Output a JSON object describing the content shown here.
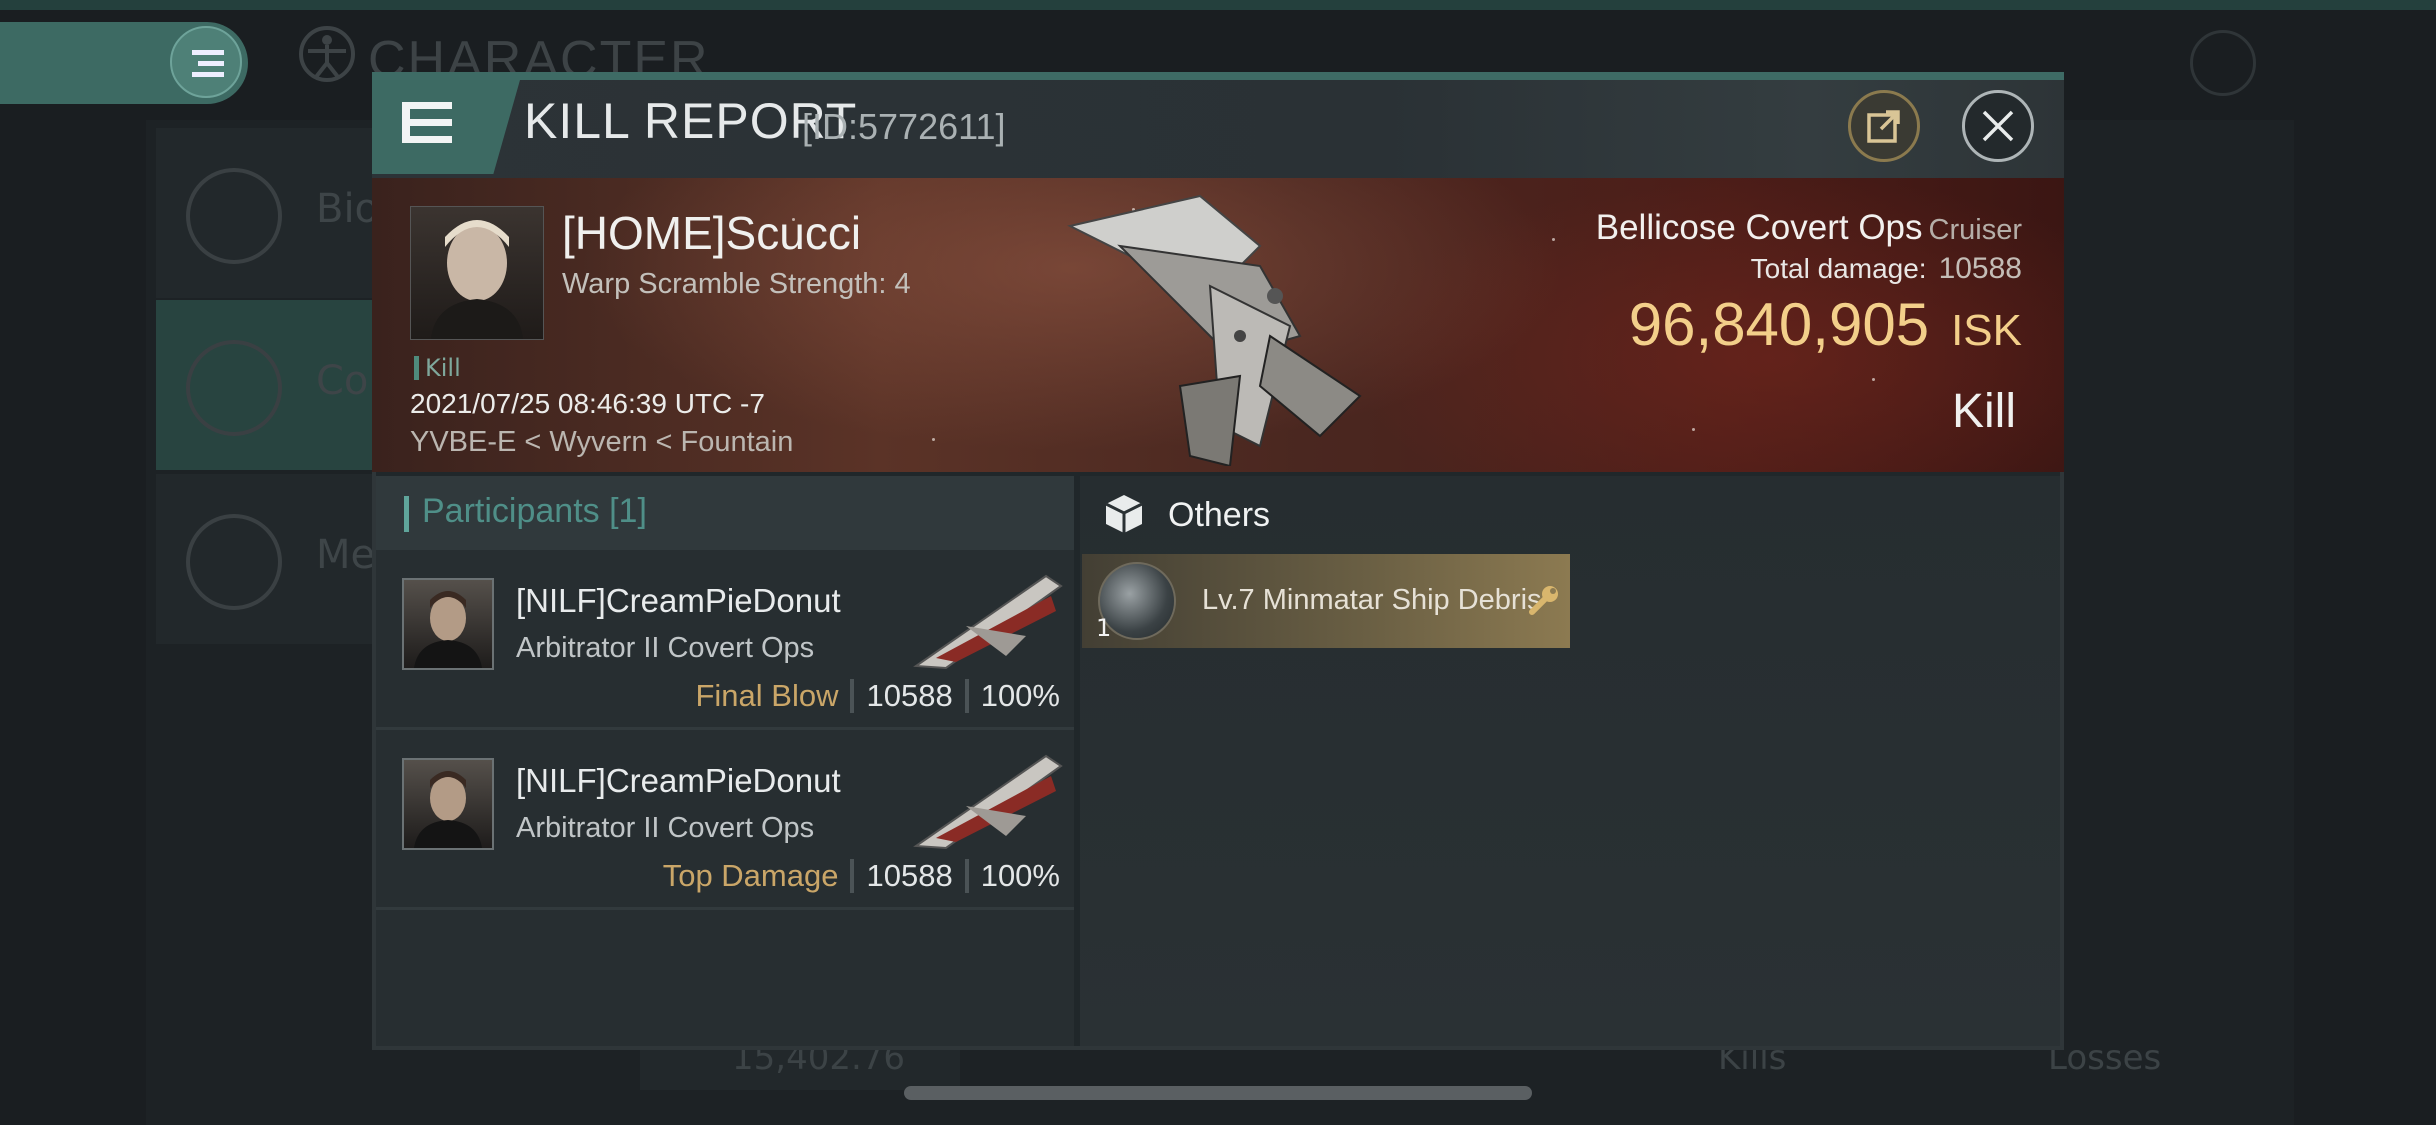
{
  "background": {
    "title": "CHARACTER",
    "sidebar": [
      {
        "label": "Bio"
      },
      {
        "label": "Co"
      },
      {
        "label": "Me"
      }
    ],
    "bottom_value": "15,402.76",
    "bottom_kills": "Kills",
    "bottom_losses": "Losses"
  },
  "modal": {
    "title": "KILL REPORT",
    "id": "[ID:5772611]"
  },
  "victim": {
    "pilot": "[HOME]Scucci",
    "warp": "Warp Scramble Strength: 4",
    "kill_tag": "Kill",
    "datetime": "2021/07/25 08:46:39 UTC -7",
    "location": "YVBE-E < Wyvern < Fountain",
    "ship": "Bellicose Covert Ops",
    "ship_class": "Cruiser",
    "total_damage_label": "Total damage:",
    "total_damage": "10588",
    "isk_value": "96,840,905",
    "isk_unit": "ISK",
    "result": "Kill"
  },
  "participants": {
    "header": "Participants [1]",
    "rows": [
      {
        "name": "[NILF]CreamPieDonut",
        "ship": "Arbitrator II Covert Ops",
        "tag": "Final Blow",
        "damage": "10588",
        "percent": "100%"
      },
      {
        "name": "[NILF]CreamPieDonut",
        "ship": "Arbitrator II Covert Ops",
        "tag": "Top Damage",
        "damage": "10588",
        "percent": "100%"
      }
    ]
  },
  "others": {
    "header": "Others",
    "items": [
      {
        "label": "Lv.7 Minmatar Ship Debris",
        "qty": "1"
      }
    ]
  },
  "colors": {
    "accent_teal": "#3d6a63",
    "isk_gold": "#f3cf8a",
    "tag_gold": "#caa668",
    "banner_red": "#5b3327"
  },
  "icons": [
    "menu-icon",
    "share-icon",
    "close-icon",
    "box-icon",
    "wrench-icon",
    "ship-icon",
    "vitruvian-icon"
  ]
}
